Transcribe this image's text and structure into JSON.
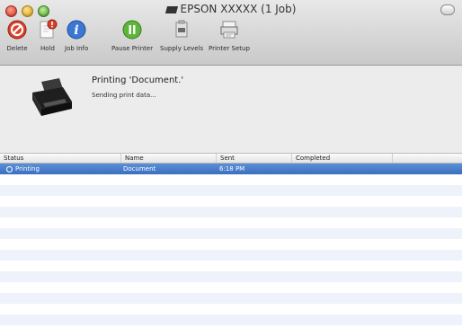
{
  "window": {
    "title": "EPSON XXXXX (1 Job)"
  },
  "toolbar": {
    "buttons": [
      {
        "label": "Delete",
        "icon": "delete-icon"
      },
      {
        "label": "Hold",
        "icon": "hold-icon"
      },
      {
        "label": "Job Info",
        "icon": "info-icon"
      },
      {
        "label": "Pause Printer",
        "icon": "pause-icon"
      },
      {
        "label": "Supply Levels",
        "icon": "supply-levels-icon"
      },
      {
        "label": "Printer Setup",
        "icon": "printer-setup-icon"
      }
    ]
  },
  "job": {
    "title": "Printing 'Document.'",
    "status": "Sending print data..."
  },
  "table": {
    "columns": [
      "Status",
      "Name",
      "Sent",
      "Completed"
    ],
    "rows": [
      {
        "status": "Printing",
        "name": "Document",
        "sent": "6:18 PM",
        "completed": ""
      }
    ]
  },
  "colors": {
    "selection": "#3a6fc0",
    "alt_row": "#edf2fb",
    "delete_red": "#d9412b",
    "info_blue": "#3a78d4",
    "pause_green": "#5fb43a"
  }
}
